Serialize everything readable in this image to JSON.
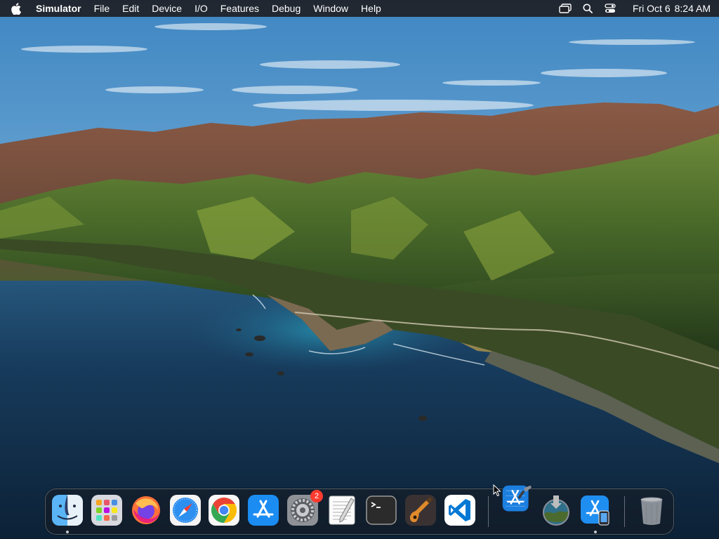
{
  "menubar": {
    "app_name": "Simulator",
    "menus": [
      "File",
      "Edit",
      "Device",
      "I/O",
      "Features",
      "Debug",
      "Window",
      "Help"
    ],
    "status_icons": [
      "screen-mirroring-icon",
      "spotlight-search-icon",
      "control-center-icon"
    ],
    "date": "Fri Oct 6",
    "time": "8:24 AM"
  },
  "dock": {
    "apps": [
      {
        "name": "Finder",
        "icon": "finder-icon",
        "running": true
      },
      {
        "name": "Launchpad",
        "icon": "launchpad-icon",
        "running": false
      },
      {
        "name": "Firefox",
        "icon": "firefox-icon",
        "running": false
      },
      {
        "name": "Safari",
        "icon": "safari-icon",
        "running": false
      },
      {
        "name": "Google Chrome",
        "icon": "chrome-icon",
        "running": false
      },
      {
        "name": "App Store",
        "icon": "app-store-icon",
        "running": false
      },
      {
        "name": "System Settings",
        "icon": "system-settings-icon",
        "running": false,
        "badge": "2"
      },
      {
        "name": "TextEdit",
        "icon": "textedit-icon",
        "running": false
      },
      {
        "name": "Terminal",
        "icon": "terminal-icon",
        "running": false
      },
      {
        "name": "GarageBand",
        "icon": "garageband-icon",
        "running": false
      },
      {
        "name": "Visual Studio Code",
        "icon": "vscode-icon",
        "running": false
      }
    ],
    "recents": [
      {
        "name": "Xcode",
        "icon": "xcode-icon",
        "running": false
      },
      {
        "name": "macOS Installer",
        "icon": "macos-installer-icon",
        "running": false
      },
      {
        "name": "Simulator",
        "icon": "simulator-icon",
        "running": true
      }
    ],
    "trash": {
      "name": "Trash",
      "icon": "trash-icon"
    }
  },
  "colors": {
    "menubar_bg": "#1e2026",
    "badge": "#ff3b30",
    "sky": "#4a90c8",
    "ocean": "#14304a"
  }
}
